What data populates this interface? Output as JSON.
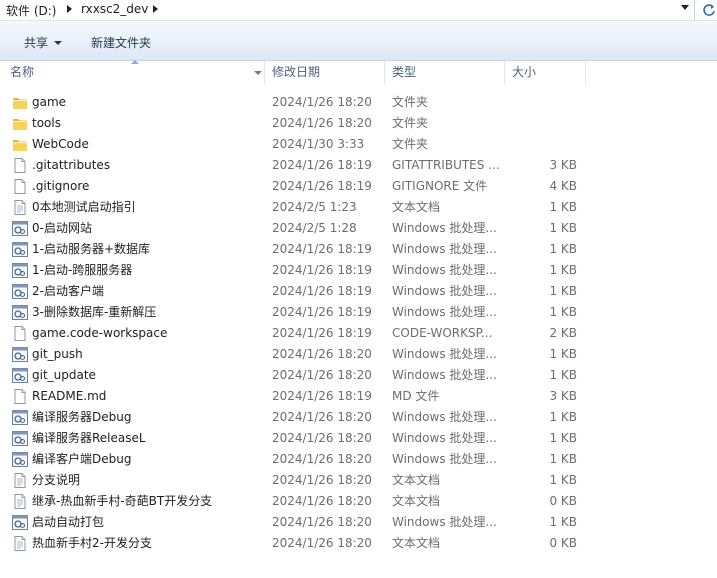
{
  "address": {
    "crumbs": [
      "软件 (D:)",
      "rxxsc2_dev"
    ]
  },
  "toolbar": {
    "share_label": "共享",
    "new_folder_label": "新建文件夹"
  },
  "columns": {
    "name": "名称",
    "date": "修改日期",
    "type": "类型",
    "size": "大小"
  },
  "files": [
    {
      "name": "game",
      "date": "2024/1/26 18:20",
      "type": "文件夹",
      "size": "",
      "icon": "folder-icon"
    },
    {
      "name": "tools",
      "date": "2024/1/26 18:20",
      "type": "文件夹",
      "size": "",
      "icon": "folder-icon"
    },
    {
      "name": "WebCode",
      "date": "2024/1/30 3:33",
      "type": "文件夹",
      "size": "",
      "icon": "folder-icon"
    },
    {
      "name": ".gitattributes",
      "date": "2024/1/26 18:19",
      "type": "GITATTRIBUTES ...",
      "size": "3 KB",
      "icon": "file-icon"
    },
    {
      "name": ".gitignore",
      "date": "2024/1/26 18:19",
      "type": "GITIGNORE 文件",
      "size": "4 KB",
      "icon": "file-icon"
    },
    {
      "name": "0本地测试启动指引",
      "date": "2024/2/5 1:23",
      "type": "文本文档",
      "size": "1 KB",
      "icon": "text-file-icon"
    },
    {
      "name": "0-启动网站",
      "date": "2024/2/5 1:28",
      "type": "Windows 批处理...",
      "size": "1 KB",
      "icon": "batch-file-icon"
    },
    {
      "name": "1-启动服务器+数据库",
      "date": "2024/1/26 18:19",
      "type": "Windows 批处理...",
      "size": "1 KB",
      "icon": "batch-file-icon"
    },
    {
      "name": "1-启动-跨服服务器",
      "date": "2024/1/26 18:19",
      "type": "Windows 批处理...",
      "size": "1 KB",
      "icon": "batch-file-icon"
    },
    {
      "name": "2-启动客户端",
      "date": "2024/1/26 18:19",
      "type": "Windows 批处理...",
      "size": "1 KB",
      "icon": "batch-file-icon"
    },
    {
      "name": "3-删除数据库-重新解压",
      "date": "2024/1/26 18:19",
      "type": "Windows 批处理...",
      "size": "1 KB",
      "icon": "batch-file-icon"
    },
    {
      "name": "game.code-workspace",
      "date": "2024/1/26 18:19",
      "type": "CODE-WORKSP...",
      "size": "2 KB",
      "icon": "file-icon"
    },
    {
      "name": "git_push",
      "date": "2024/1/26 18:20",
      "type": "Windows 批处理...",
      "size": "1 KB",
      "icon": "batch-file-icon"
    },
    {
      "name": "git_update",
      "date": "2024/1/26 18:20",
      "type": "Windows 批处理...",
      "size": "1 KB",
      "icon": "batch-file-icon"
    },
    {
      "name": "README.md",
      "date": "2024/1/26 18:19",
      "type": "MD 文件",
      "size": "3 KB",
      "icon": "file-icon"
    },
    {
      "name": "编译服务器Debug",
      "date": "2024/1/26 18:20",
      "type": "Windows 批处理...",
      "size": "1 KB",
      "icon": "batch-file-icon"
    },
    {
      "name": "编译服务器ReleaseL",
      "date": "2024/1/26 18:20",
      "type": "Windows 批处理...",
      "size": "1 KB",
      "icon": "batch-file-icon"
    },
    {
      "name": "编译客户端Debug",
      "date": "2024/1/26 18:20",
      "type": "Windows 批处理...",
      "size": "1 KB",
      "icon": "batch-file-icon"
    },
    {
      "name": "分支说明",
      "date": "2024/1/26 18:20",
      "type": "文本文档",
      "size": "1 KB",
      "icon": "text-file-icon"
    },
    {
      "name": "继承-热血新手村-奇葩BT开发分支",
      "date": "2024/1/26 18:20",
      "type": "文本文档",
      "size": "0 KB",
      "icon": "text-file-icon"
    },
    {
      "name": "启动自动打包",
      "date": "2024/1/26 18:20",
      "type": "Windows 批处理...",
      "size": "1 KB",
      "icon": "batch-file-icon"
    },
    {
      "name": "热血新手村2-开发分支",
      "date": "2024/1/26 18:20",
      "type": "文本文档",
      "size": "0 KB",
      "icon": "text-file-icon"
    }
  ]
}
